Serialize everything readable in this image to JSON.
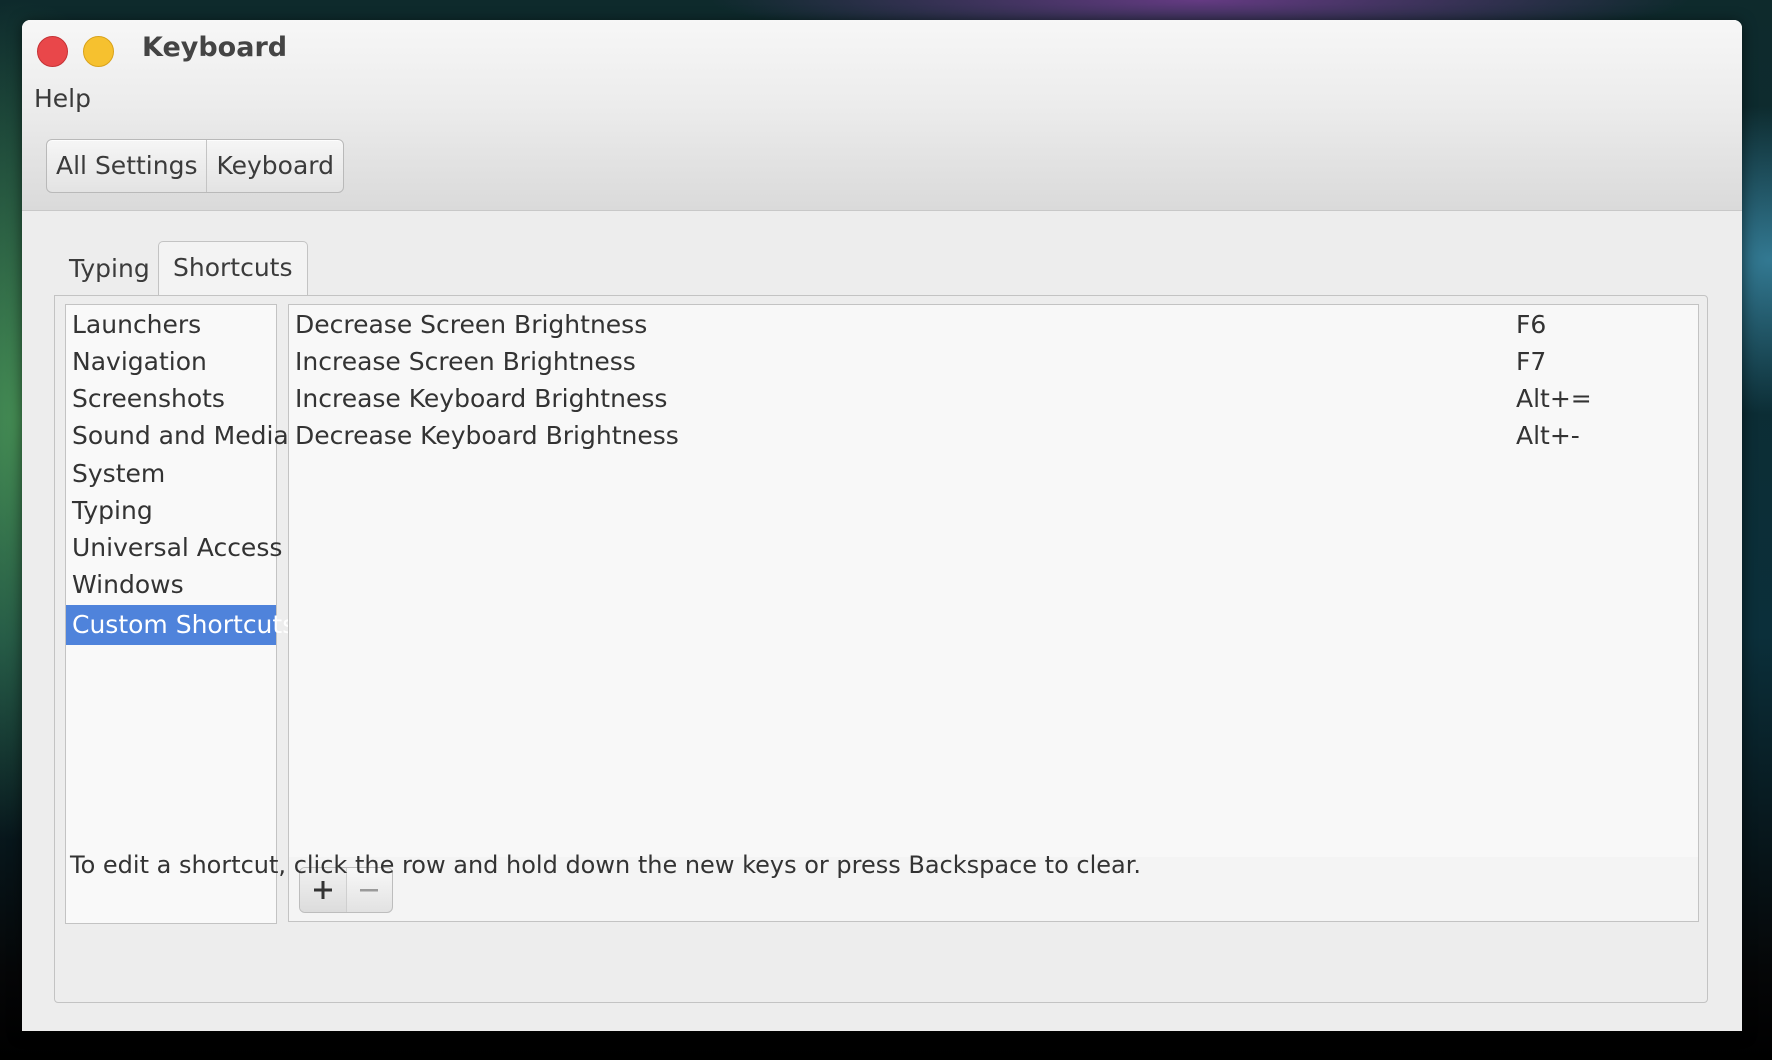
{
  "window": {
    "title": "Keyboard"
  },
  "menu": {
    "help": "Help"
  },
  "breadcrumb": [
    "All Settings",
    "Keyboard"
  ],
  "tabs": [
    {
      "label": "Typing",
      "active": false
    },
    {
      "label": "Shortcuts",
      "active": true
    }
  ],
  "categories": [
    "Launchers",
    "Navigation",
    "Screenshots",
    "Sound and Media",
    "System",
    "Typing",
    "Universal Access",
    "Windows",
    "Custom Shortcuts"
  ],
  "selected_category": "Custom Shortcuts",
  "shortcuts": [
    {
      "name": "Decrease Screen Brightness",
      "key": "F6"
    },
    {
      "name": "Increase Screen Brightness",
      "key": "F7"
    },
    {
      "name": "Increase Keyboard Brightness",
      "key": "Alt+="
    },
    {
      "name": "Decrease Keyboard Brightness",
      "key": "Alt+-"
    }
  ],
  "toolbar": {
    "add_icon": "plus-icon",
    "remove_icon": "minus-icon"
  },
  "hint": "To edit a shortcut, click the row and hold down the new keys or press Backspace to clear.",
  "colors": {
    "selection": "#4f83db",
    "close": "#e9474a",
    "minimize": "#f6c12f"
  }
}
